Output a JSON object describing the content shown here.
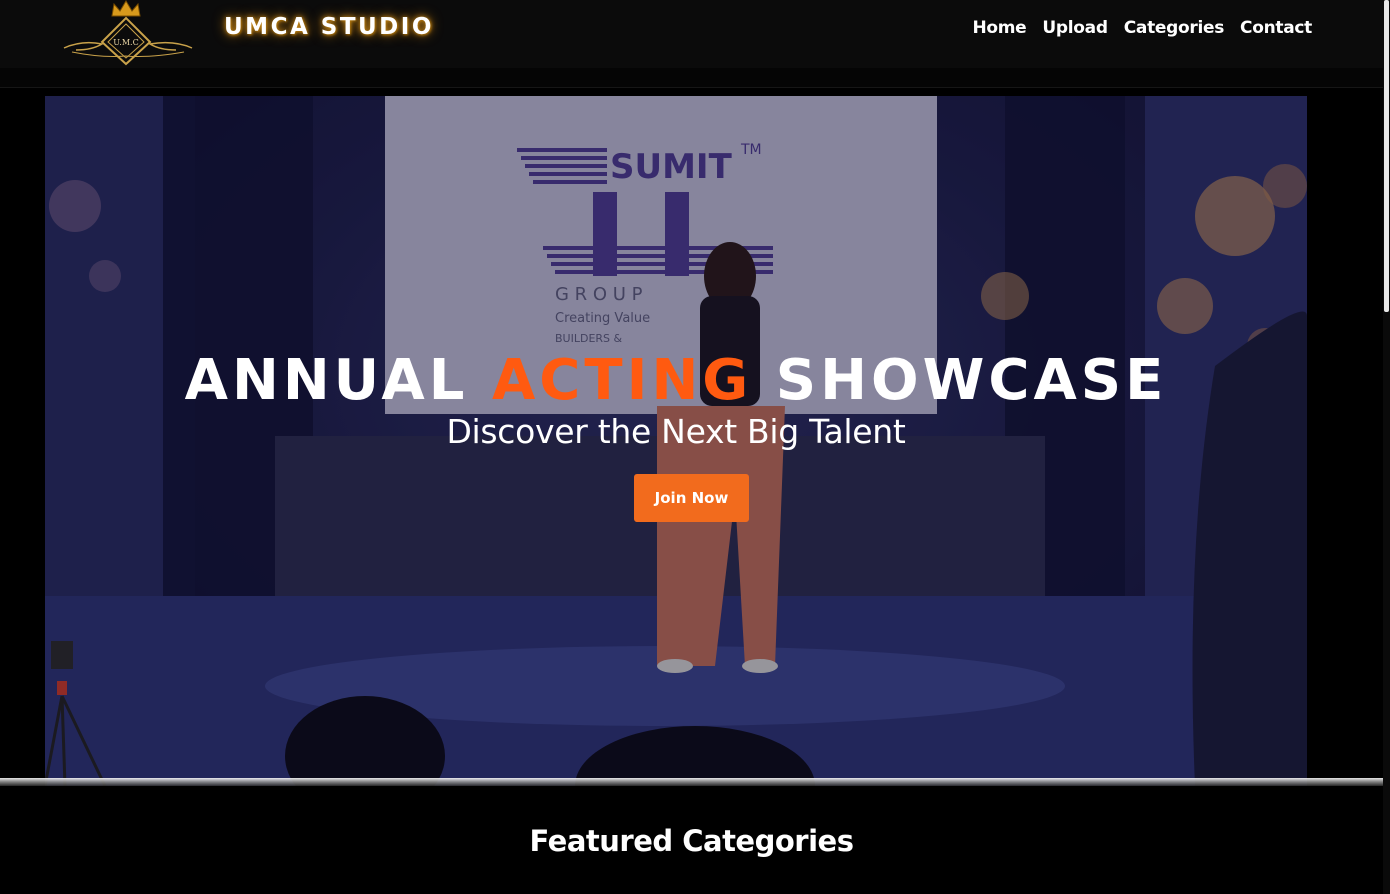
{
  "header": {
    "logo_text": "U.M.C",
    "brand": "UMCA STUDIO",
    "nav": [
      {
        "label": "Home"
      },
      {
        "label": "Upload"
      },
      {
        "label": "Categories"
      },
      {
        "label": "Contact"
      }
    ]
  },
  "hero": {
    "title_part1": "ANNUAL",
    "title_accent": "ACTING",
    "title_part2": "SHOWCASE",
    "subtitle": "Discover the Next Big Talent",
    "cta_label": "Join Now",
    "banner": {
      "brand": "SUMIT",
      "trademark": "TM",
      "group": "G R O U P",
      "tagline": "Creating Value",
      "line3": "BUILDERS &"
    }
  },
  "featured": {
    "title": "Featured Categories"
  },
  "colors": {
    "accent": "#ff5a10",
    "button": "#f26b1d",
    "header_bg": "#0b0b0b",
    "gold": "#c88a1a"
  }
}
